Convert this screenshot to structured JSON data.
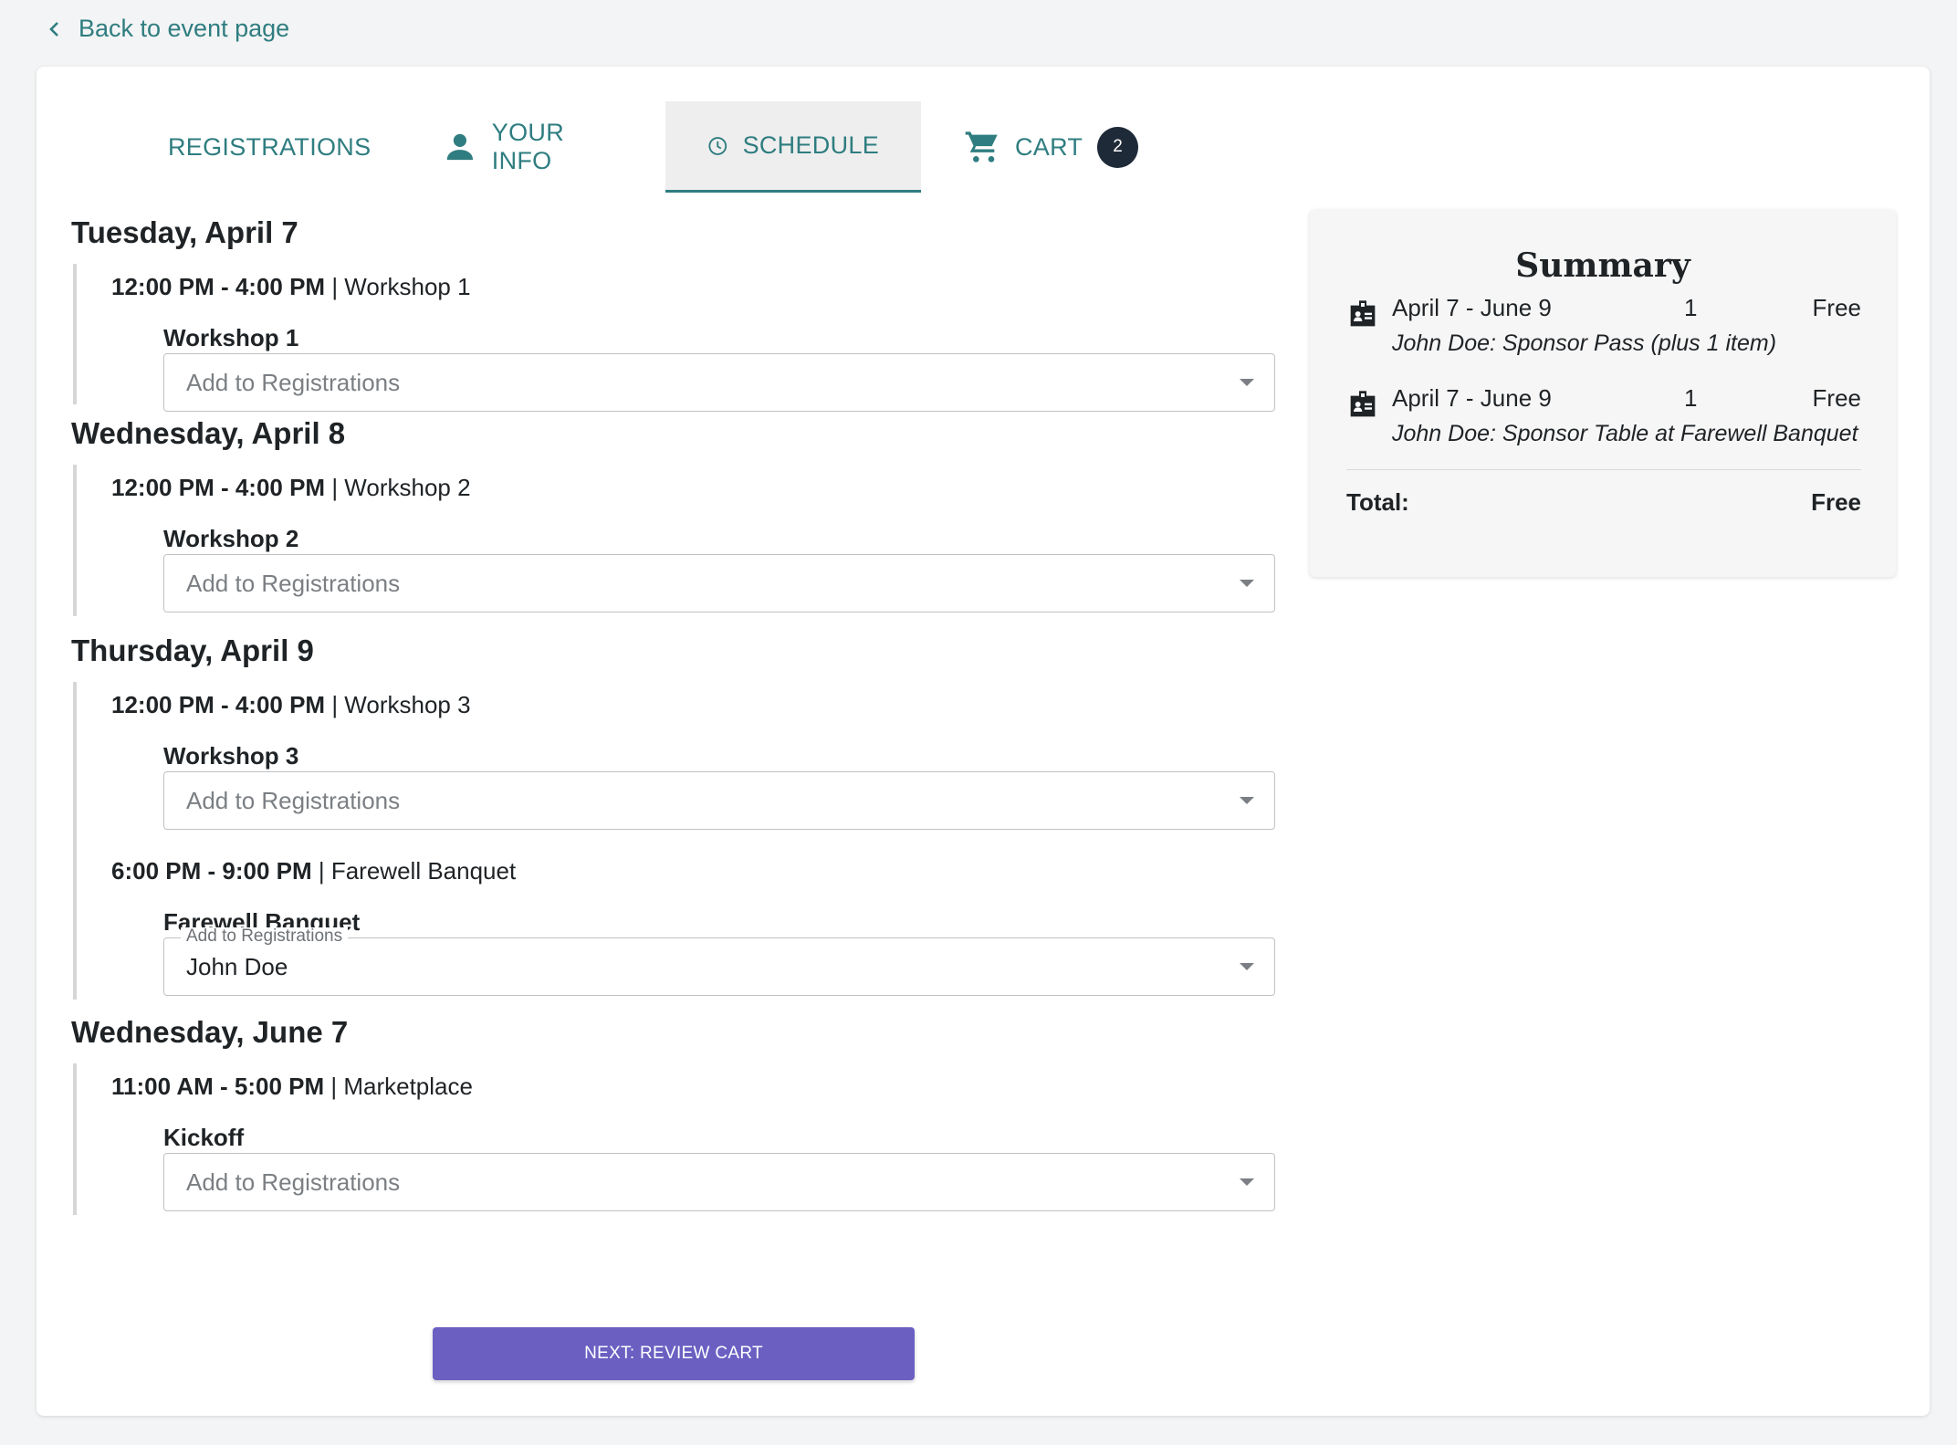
{
  "nav": {
    "back_label": "Back to event page"
  },
  "tabs": [
    {
      "label": "REGISTRATIONS",
      "icon": "ticket-star-icon"
    },
    {
      "label": "YOUR INFO",
      "icon": "person-icon"
    },
    {
      "label": "SCHEDULE",
      "icon": "clock-icon",
      "active": true
    },
    {
      "label": "CART",
      "icon": "cart-icon",
      "badge": "2"
    }
  ],
  "schedule": {
    "days": [
      {
        "title": "Tuesday, April 7",
        "sessions": [
          {
            "time": "12:00 PM - 4:00 PM",
            "name": "Workshop 1",
            "item": "Workshop 1",
            "select_value": "",
            "select_placeholder": "Add to Registrations"
          }
        ]
      },
      {
        "title": "Wednesday, April 8",
        "sessions": [
          {
            "time": "12:00 PM - 4:00 PM",
            "name": "Workshop 2",
            "item": "Workshop 2",
            "select_value": "",
            "select_placeholder": "Add to Registrations"
          }
        ]
      },
      {
        "title": "Thursday, April 9",
        "sessions": [
          {
            "time": "12:00 PM - 4:00 PM",
            "name": "Workshop 3",
            "item": "Workshop 3",
            "select_value": "",
            "select_placeholder": "Add to Registrations"
          },
          {
            "time": "6:00 PM - 9:00 PM",
            "name": "Farewell Banquet",
            "item": "Farewell Banquet",
            "select_value": "John Doe",
            "select_placeholder": "Add to Registrations"
          }
        ]
      },
      {
        "title": "Wednesday, June 7",
        "sessions": [
          {
            "time": "11:00 AM - 5:00 PM",
            "name": "Marketplace",
            "item": "Kickoff",
            "select_value": "",
            "select_placeholder": "Add to Registrations"
          }
        ]
      }
    ],
    "separator": " | "
  },
  "actions": {
    "next_label": "NEXT: REVIEW CART"
  },
  "summary": {
    "title": "Summary",
    "items": [
      {
        "dates": "April 7 - June 9",
        "qty": "1",
        "price": "Free",
        "desc": "John Doe: Sponsor Pass (plus 1 item)",
        "icon": "badge-id-icon"
      },
      {
        "dates": "April 7 - June 9",
        "qty": "1",
        "price": "Free",
        "desc": "John Doe: Sponsor Table at Farewell Banquet",
        "icon": "badge-id-icon"
      }
    ],
    "total_label": "Total:",
    "total_value": "Free"
  },
  "colors": {
    "accent": "#2f7d80",
    "button": "#6b5fc2",
    "badge": "#1f2a38"
  }
}
